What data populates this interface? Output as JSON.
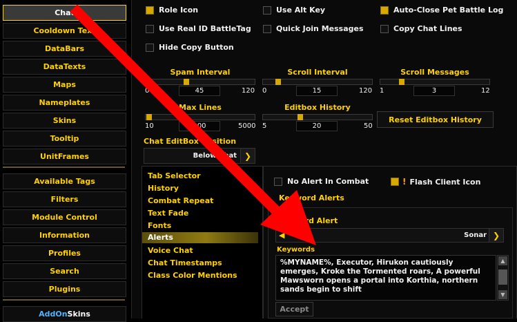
{
  "sidebar": {
    "group1": [
      "Chat",
      "Cooldown Text",
      "DataBars",
      "DataTexts",
      "Maps",
      "Nameplates",
      "Skins",
      "Tooltip",
      "UnitFrames"
    ],
    "group2": [
      "Available Tags",
      "Filters",
      "Module Control",
      "Information",
      "Profiles",
      "Search",
      "Plugins"
    ],
    "addon_a": "AddOn",
    "addon_b": "Skins",
    "active": "Chat"
  },
  "general": {
    "checkboxes": [
      {
        "label": "Role Icon",
        "checked": true
      },
      {
        "label": "Use Alt Key",
        "checked": false
      },
      {
        "label": "Auto-Close Pet Battle Log",
        "checked": true
      },
      {
        "label": "Use Real ID BattleTag",
        "checked": false
      },
      {
        "label": "Quick Join Messages",
        "checked": false
      },
      {
        "label": "Copy Chat Lines",
        "checked": false
      },
      {
        "label": "Hide Copy Button",
        "checked": false
      }
    ],
    "sliders": [
      {
        "label": "Spam Interval",
        "min": "0",
        "max": "120",
        "value": "45"
      },
      {
        "label": "Scroll Interval",
        "min": "0",
        "max": "120",
        "value": "15"
      },
      {
        "label": "Scroll Messages",
        "min": "1",
        "max": "12",
        "value": "3"
      },
      {
        "label": "Max Lines",
        "min": "10",
        "max": "5000",
        "value": "100"
      },
      {
        "label": "Editbox History",
        "min": "5",
        "max": "50",
        "value": "20"
      }
    ],
    "reset_button": "Reset Editbox History",
    "editbox_position_label": "Chat EditBox Position",
    "editbox_position_value": "Below Chat"
  },
  "tree": {
    "items": [
      "Tab Selector",
      "History",
      "Combat Repeat",
      "Text Fade",
      "Fonts",
      "Alerts",
      "Voice Chat",
      "Chat Timestamps",
      "Class Color Mentions"
    ],
    "selected": "Alerts"
  },
  "alerts": {
    "no_alert_label": "No Alert In Combat",
    "flash_label": "Flash Client Icon",
    "flash_icon": "exclamation-icon",
    "keyword_alerts_heading": "Keyword Alerts",
    "keyword_alert_label": "Keyword Alert",
    "sound_value": "Sonar",
    "sound_icon": "speaker-icon",
    "keywords_label": "Keywords",
    "keywords_text": "%MYNAME%, Executor, Hirukon cautiously emerges, Kroke the Tormented roars, A powerful Mawsworn opens a portal into Korthia, northern sands begin to shift",
    "accept_label": "Accept"
  },
  "colors": {
    "accent": "#ffd100",
    "checked": "#d6a800",
    "arrow": "#ff0000"
  }
}
